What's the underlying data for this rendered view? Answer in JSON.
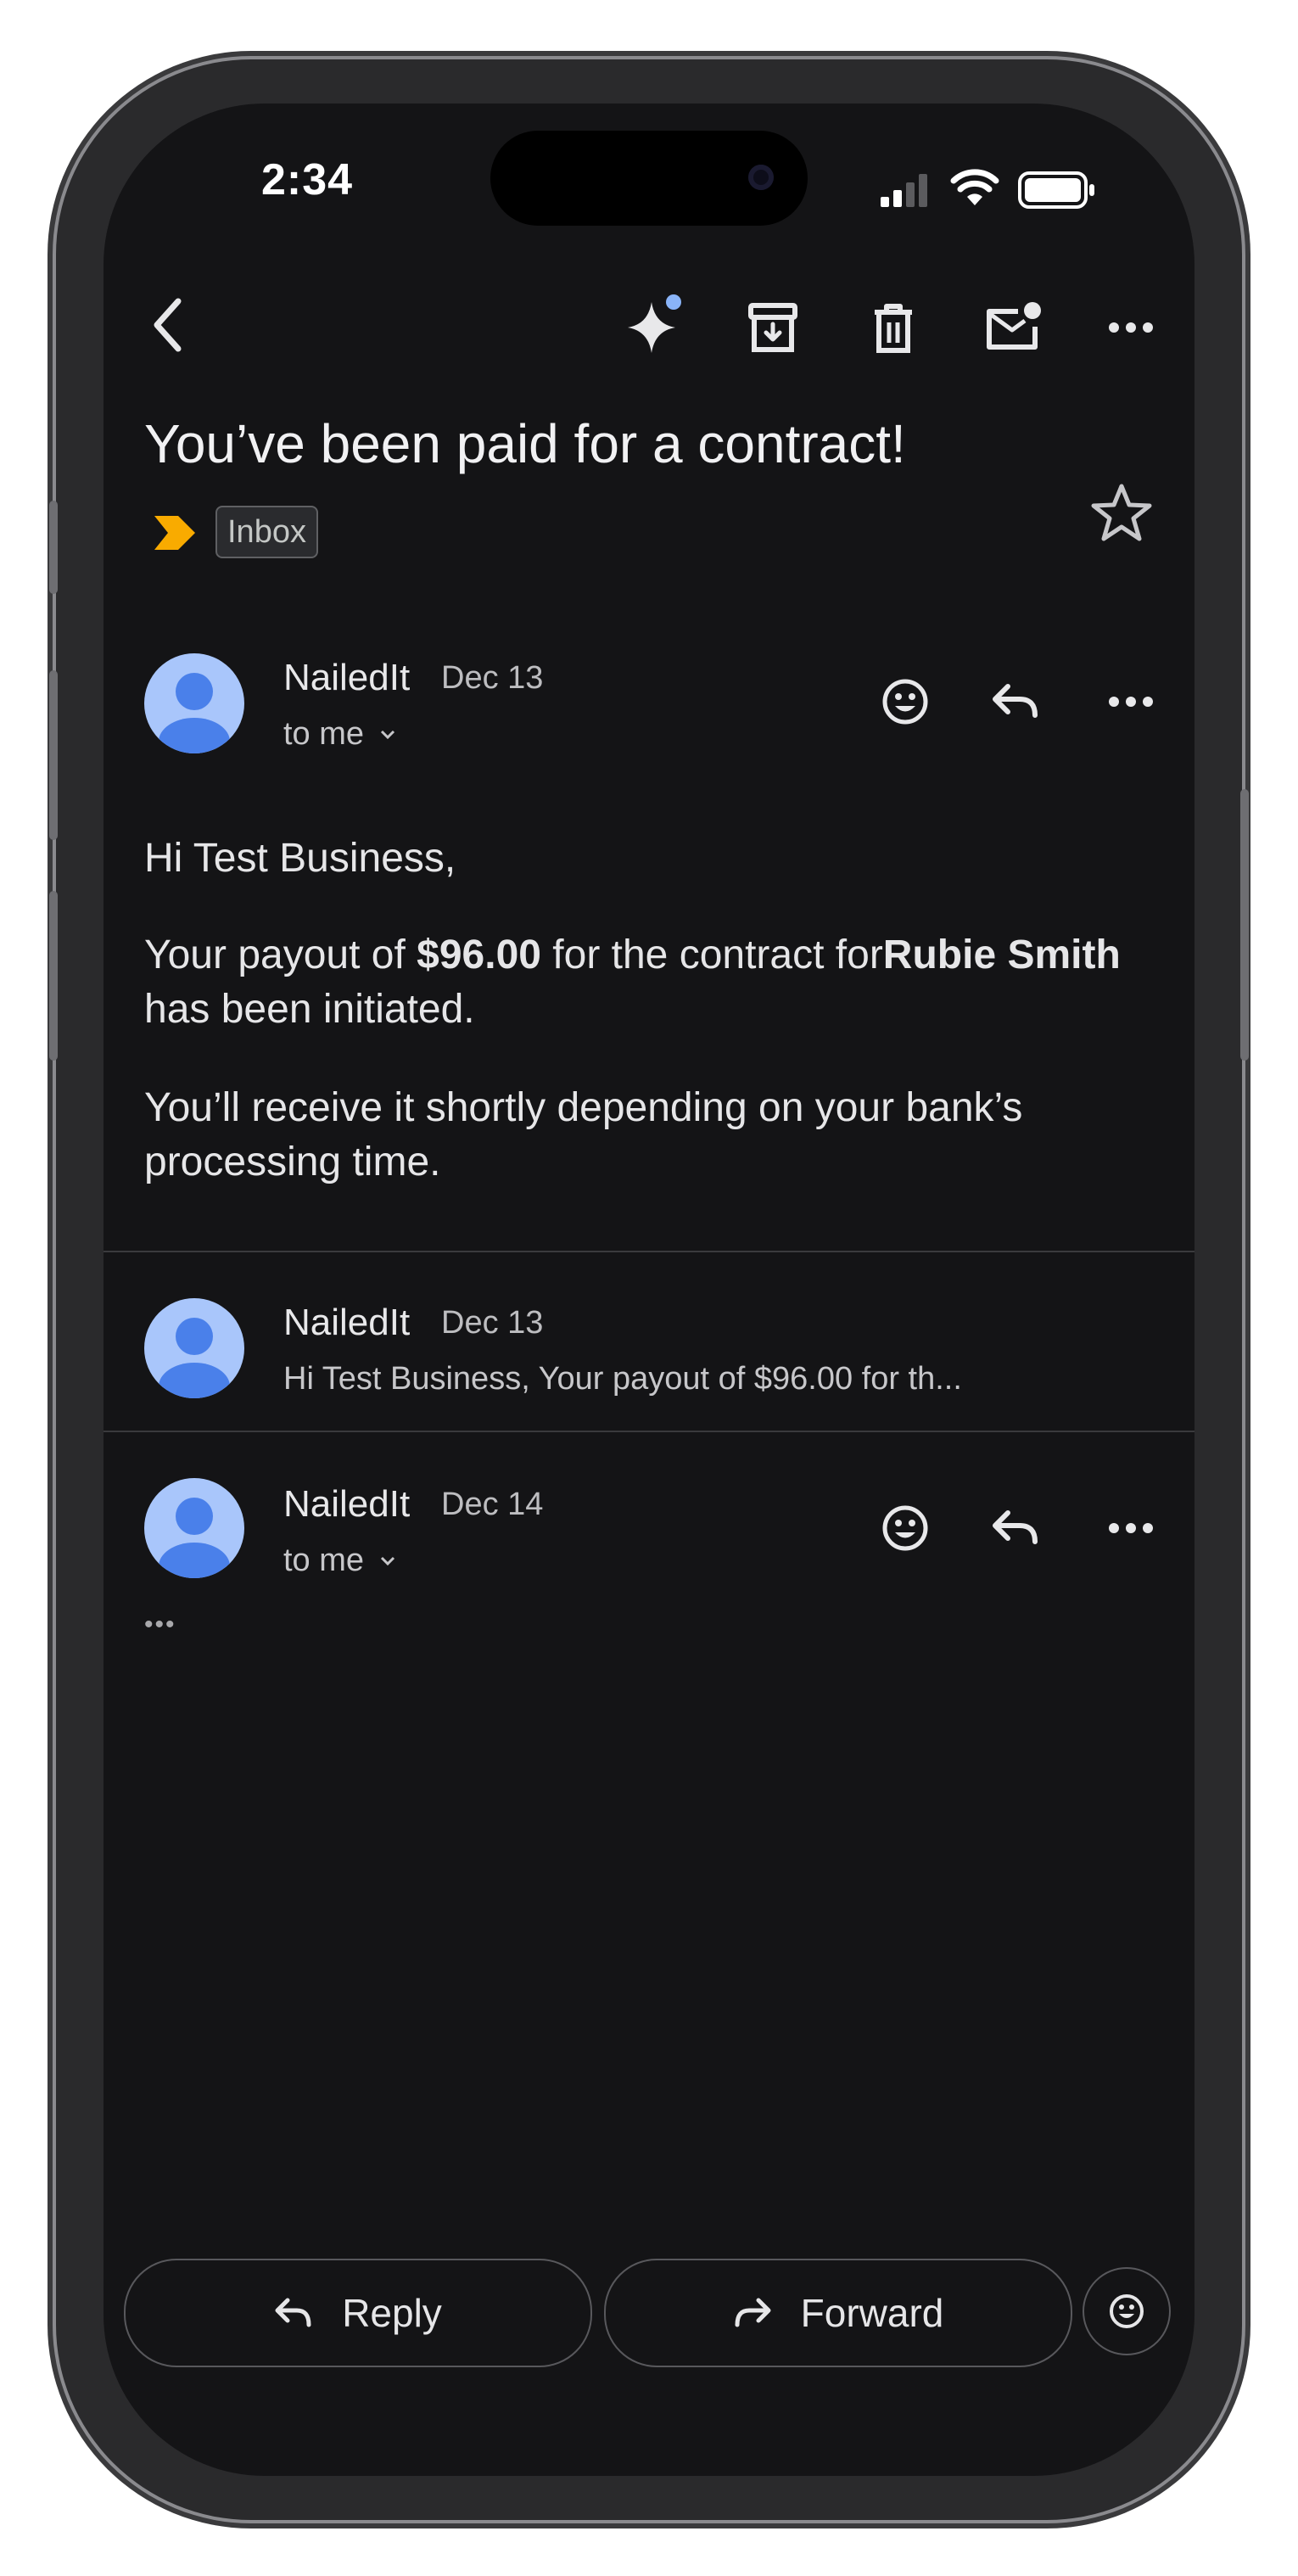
{
  "status_bar": {
    "time": "2:34"
  },
  "toolbar": {
    "back_icon": "chevron-left-icon",
    "actions": [
      "sparkle-icon",
      "archive-icon",
      "trash-icon",
      "mark-unread-icon",
      "more-horizontal-icon"
    ]
  },
  "email": {
    "subject": "You’ve been paid for a contract!",
    "label": "Inbox",
    "importance_color": "#f9ab00"
  },
  "messages": [
    {
      "sender": "NailedIt",
      "date": "Dec 13",
      "recipient": "to me",
      "greeting": "Hi Test Business,",
      "para1_prefix": "Your payout of ",
      "para1_amount": "$96.00",
      "para1_middle": " for the contract for",
      "para1_name": "Rubie Smith",
      "para1_suffix": " has been initiated.",
      "para2": "You’ll receive it shortly depending on your bank’s processing time."
    },
    {
      "sender": "NailedIt",
      "date": "Dec 13",
      "snippet": "Hi Test Business, Your payout of $96.00 for th..."
    },
    {
      "sender": "NailedIt",
      "date": "Dec 14",
      "recipient": "to me",
      "ellipsis": "•••"
    }
  ],
  "bottom_bar": {
    "reply_label": "Reply",
    "forward_label": "Forward"
  },
  "colors": {
    "background": "#141416",
    "avatar_bg": "#a9c6fb",
    "avatar_fg": "#4a80ea",
    "badge_dot": "#8ab4f8"
  }
}
